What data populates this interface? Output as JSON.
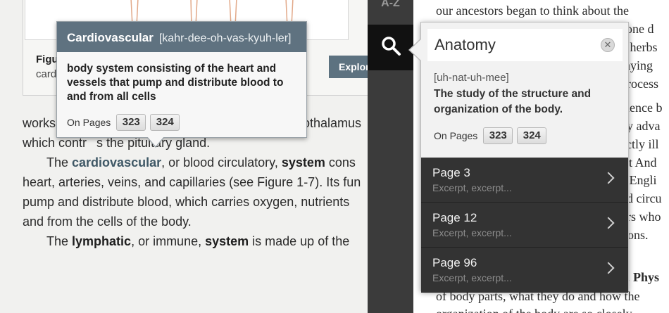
{
  "left_page": {
    "figure": {
      "caption_title": "Figu",
      "caption_sub": "card",
      "explore_label": "Explore thi"
    },
    "lines": {
      "l1_a": "works",
      "l1_b": "othalamus",
      "l2_a": "which contr",
      "l2_b": "s the pituitary gland.",
      "l3_a": "The ",
      "l3_term": "cardiovascular",
      "l3_b": ", or blood circulatory, ",
      "l3_bold": "system",
      "l3_c": " cons",
      "l4": "heart, arteries, veins, and capillaries (see Figure 1-7). Its fun",
      "l5": "pump and distribute blood, which carries oxygen, nutrients",
      "l6": "and from the cells of the body.",
      "l7_a": "The ",
      "l7_bold1": "lymphatic",
      "l7_b": ", or immune, ",
      "l7_bold2": "system",
      "l7_c": " is made up of the"
    }
  },
  "glossary_popup": {
    "term": "Cardiovascular",
    "pronunciation": "[kahr-dee-oh-vas-kyuh-ler]",
    "definition": "body system consisting of the heart and vessels that pump and distribute blood to and from all cells",
    "pages_label": "On Pages",
    "pages": [
      "323",
      "324"
    ]
  },
  "sidebar": {
    "az_label": "A-Z",
    "search_icon": "search-icon"
  },
  "right_page": {
    "top_line": "our ancestors began to think about the",
    "fragments": [
      "eone d",
      "d herbs",
      "raying",
      "process",
      "cience b",
      "dy adva",
      "ectly ill",
      "ist And",
      "e Engli",
      "od circu",
      "ors who",
      "tions."
    ],
    "bottom_1a": "d. ",
    "bottom_1b": "Phys",
    "bottom_2": "of body parts, what they do and how the",
    "bottom_3": "organization of the body are so closely"
  },
  "search_popup": {
    "query": "Anatomy",
    "pronunciation": "[uh-nat-uh-mee]",
    "definition": "The study of the structure and organization of the body.",
    "pages_label": "On Pages",
    "pages": [
      "323",
      "324"
    ],
    "results": [
      {
        "title": "Page 3",
        "excerpt": "Excerpt, excerpt..."
      },
      {
        "title": "Page 12",
        "excerpt": "Excerpt, excerpt..."
      },
      {
        "title": "Page 96",
        "excerpt": "Excerpt, excerpt..."
      }
    ]
  },
  "colors": {
    "popup_header": "#5f7280",
    "sidebar": "#3b3b3b",
    "result_row": "#333333",
    "term_link": "#3f5866"
  }
}
